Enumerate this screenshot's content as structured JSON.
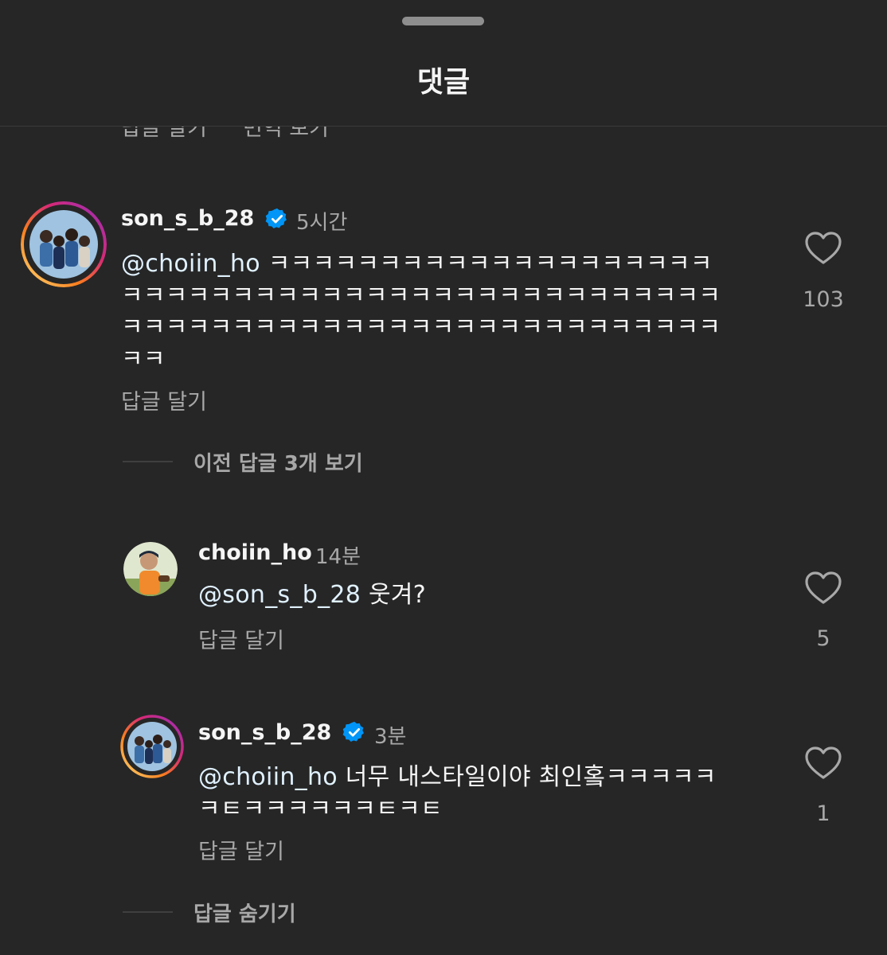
{
  "sheet": {
    "title": "댓글"
  },
  "partial_prev": {
    "reply": "답글 달기",
    "translate": "번역 보기"
  },
  "comment_main": {
    "username": "son_s_b_28",
    "verified": true,
    "time": "5시간",
    "mention": "@choiin_ho",
    "line1_text": "ㅋㅋㅋㅋㅋㅋㅋㅋㅋㅋㅋㅋㅋㅋㅋㅋㅋㅋㅋㅋ",
    "line2": "ㅋㅋㅋㅋㅋㅋㅋㅋㅋㅋㅋㅋㅋㅋㅋㅋㅋㅋㅋㅋㅋㅋㅋㅋㅋㅋㅋ",
    "line3": "ㅋㅋㅋㅋㅋㅋㅋㅋㅋㅋㅋㅋㅋㅋㅋㅋㅋㅋㅋㅋㅋㅋㅋㅋㅋㅋㅋ",
    "line4": "ㅋㅋ",
    "reply": "답글 달기",
    "likes": "103"
  },
  "view_prev_replies": "이전 답글 3개 보기",
  "reply_1": {
    "username": "choiin_ho",
    "time": "14분",
    "mention": "@son_s_b_28",
    "text": " 웃겨?",
    "reply": "답글 달기",
    "likes": "5"
  },
  "reply_2": {
    "username": "son_s_b_28",
    "verified": true,
    "time": "3분",
    "mention": "@choiin_ho",
    "line1_text": " 너무 내스타일이야 최인홐ㅋㅋㅋㅋㅋ",
    "line2": "ㅋㅌㅋㅋㅋㅋㅋㅋㅌㅋㅌ",
    "reply": "답글 달기",
    "likes": "1"
  },
  "hide_replies": "답글 숨기기",
  "colors": {
    "background": "#262626",
    "text": "#f5f5f5",
    "secondary": "#a8a8a8",
    "verified": "#0095f6",
    "mention": "#e0f1ff"
  },
  "icons": {
    "heart": "heart-outline-icon",
    "verified": "verified-badge-icon"
  }
}
